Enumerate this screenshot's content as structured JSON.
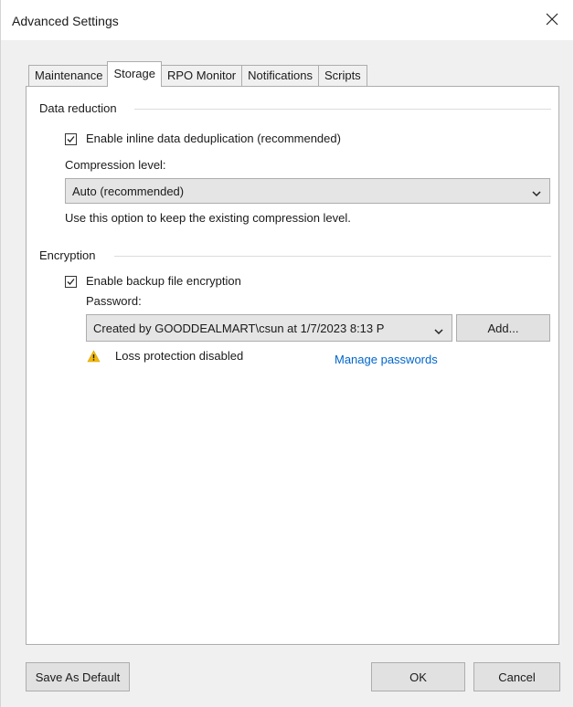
{
  "window": {
    "title": "Advanced Settings"
  },
  "tabs": [
    {
      "label": "Maintenance",
      "active": false
    },
    {
      "label": "Storage",
      "active": true
    },
    {
      "label": "RPO Monitor",
      "active": false
    },
    {
      "label": "Notifications",
      "active": false
    },
    {
      "label": "Scripts",
      "active": false
    }
  ],
  "data_reduction": {
    "group_label": "Data reduction",
    "dedup_checkbox_label": "Enable inline data deduplication (recommended)",
    "dedup_checked": true,
    "compression_label": "Compression level:",
    "compression_value": "Auto (recommended)",
    "compression_hint": "Use this option to keep the existing compression level."
  },
  "encryption": {
    "group_label": "Encryption",
    "encrypt_checkbox_label": "Enable backup file encryption",
    "encrypt_checked": true,
    "password_label": "Password:",
    "password_value": "Created by GOODDEALMART\\csun at 1/7/2023 8:13 P",
    "add_button": "Add...",
    "warning_text": "Loss protection disabled",
    "manage_link": "Manage passwords"
  },
  "footer": {
    "save_default_button": "Save As Default",
    "ok_button": "OK",
    "cancel_button": "Cancel"
  },
  "colors": {
    "link": "#0066cc",
    "warning_icon": "#f2b90c",
    "panel_bg": "#ffffff",
    "window_bg": "#f0f0f0"
  }
}
